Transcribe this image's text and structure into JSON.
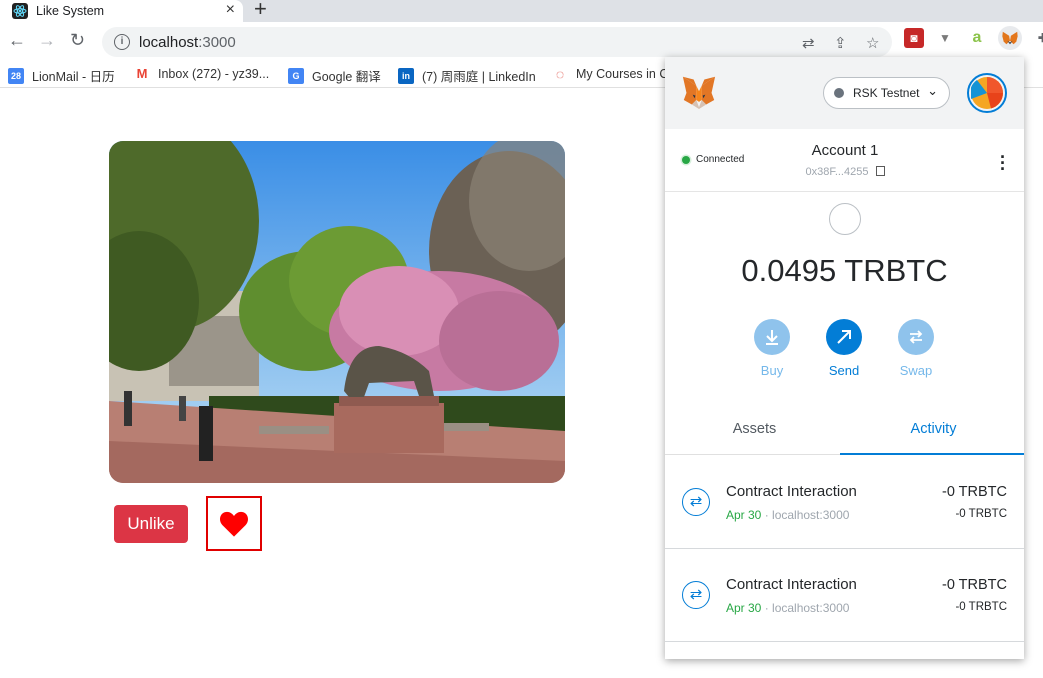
{
  "browser": {
    "tab_title": "Like System",
    "tab_close": "×",
    "new_tab": "+",
    "url_host": "localhost",
    "url_port": ":3000",
    "bookmarks": [
      {
        "label": "LionMail - 日历",
        "icon": "calendar-icon",
        "color": "#4285f4",
        "glyph": "28"
      },
      {
        "label": "Inbox (272) - yz39...",
        "icon": "gmail-icon",
        "color": "#ea4335",
        "glyph": "M"
      },
      {
        "label": "Google 翻译",
        "icon": "google-translate-icon",
        "color": "#4285f4",
        "glyph": "G"
      },
      {
        "label": "(7) 周雨庭 | LinkedIn",
        "icon": "linkedin-icon",
        "color": "#0a66c2",
        "glyph": "in"
      },
      {
        "label": "My Courses in C",
        "icon": "courses-icon",
        "color": "#d93025",
        "glyph": "◌"
      }
    ]
  },
  "page": {
    "unlike_label": "Unlike",
    "like_state": "liked",
    "heart_color": "#ff0000"
  },
  "metamask": {
    "network": "RSK Testnet",
    "status": "Connected",
    "account_name": "Account 1",
    "account_address": "0x38F...4255",
    "balance": "0.0495 TRBTC",
    "actions": [
      {
        "label": "Buy",
        "icon": "download-icon",
        "enabled": false
      },
      {
        "label": "Send",
        "icon": "send-arrow-icon",
        "enabled": true
      },
      {
        "label": "Swap",
        "icon": "swap-icon",
        "enabled": false
      }
    ],
    "tabs": [
      {
        "label": "Assets",
        "active": false
      },
      {
        "label": "Activity",
        "active": true
      }
    ],
    "transactions": [
      {
        "title": "Contract Interaction",
        "date": "Apr 30",
        "origin": "localhost:3000",
        "amount": "-0 TRBTC",
        "fiat": "-0 TRBTC"
      },
      {
        "title": "Contract Interaction",
        "date": "Apr 30",
        "origin": "localhost:3000",
        "amount": "-0 TRBTC",
        "fiat": "-0 TRBTC"
      }
    ],
    "colors": {
      "accent": "#037dd6",
      "connected": "#28a745"
    }
  }
}
